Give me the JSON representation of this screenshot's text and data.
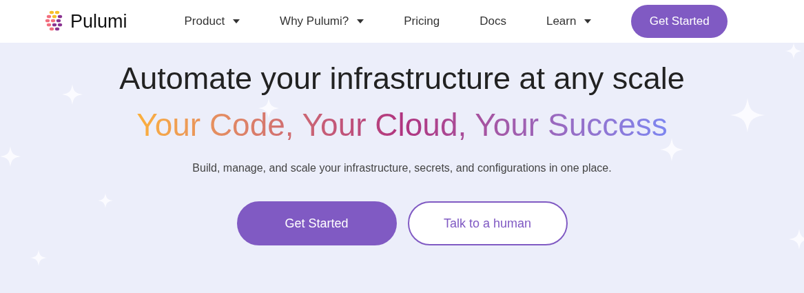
{
  "header": {
    "logo_text": "Pulumi",
    "nav": [
      {
        "label": "Product",
        "has_menu": true
      },
      {
        "label": "Why Pulumi?",
        "has_menu": true
      },
      {
        "label": "Pricing",
        "has_menu": false
      },
      {
        "label": "Docs",
        "has_menu": false
      },
      {
        "label": "Learn",
        "has_menu": true
      }
    ],
    "cta": "Get Started"
  },
  "hero": {
    "title": "Automate your infrastructure at any scale",
    "tagline": "Your Code, Your Cloud, Your Success",
    "description": "Build, manage, and scale your infrastructure, secrets, and configurations in one place.",
    "buttons": [
      {
        "label": "Get Started",
        "kind": "primary"
      },
      {
        "label": "Talk to a human",
        "kind": "outline"
      }
    ]
  }
}
